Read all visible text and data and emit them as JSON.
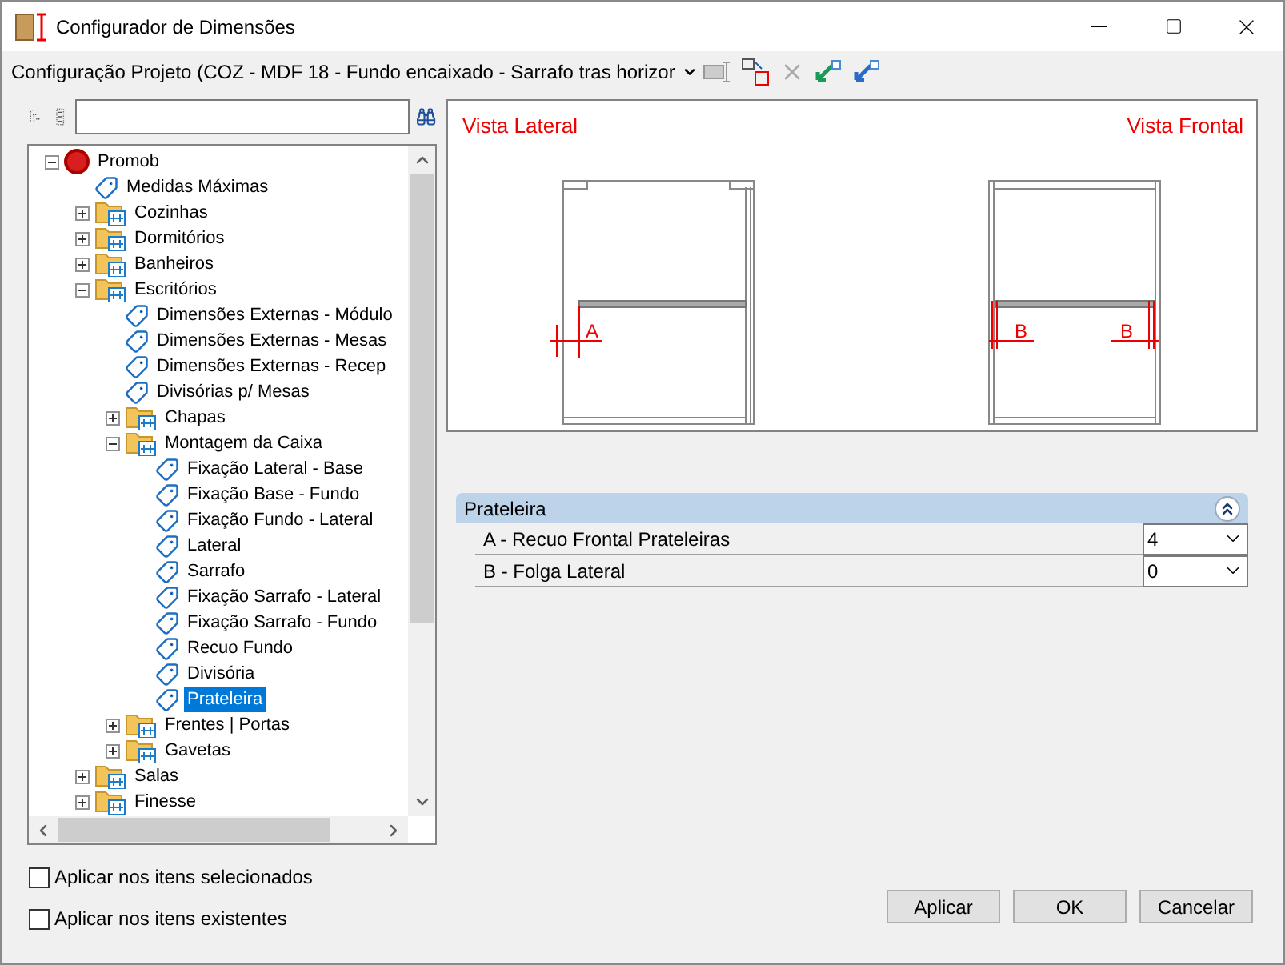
{
  "window": {
    "title": "Configurador de Dimensões"
  },
  "config": {
    "value": "Configuração Projeto (COZ - MDF 18 - Fundo encaixado - Sarrafo tras horizor"
  },
  "tree": [
    {
      "label": "Promob",
      "kind": "root",
      "expanded": true,
      "selected": false,
      "children": [
        {
          "label": "Medidas Máximas",
          "kind": "item",
          "selected": false
        },
        {
          "label": "Cozinhas",
          "kind": "folder",
          "expanded": false,
          "selected": false
        },
        {
          "label": "Dormitórios",
          "kind": "folder",
          "expanded": false,
          "selected": false
        },
        {
          "label": "Banheiros",
          "kind": "folder",
          "expanded": false,
          "selected": false
        },
        {
          "label": "Escritórios",
          "kind": "folder",
          "expanded": true,
          "selected": false,
          "children": [
            {
              "label": "Dimensões Externas - Módulo",
              "kind": "item",
              "selected": false
            },
            {
              "label": "Dimensões Externas - Mesas",
              "kind": "item",
              "selected": false
            },
            {
              "label": "Dimensões Externas - Recep",
              "kind": "item",
              "selected": false
            },
            {
              "label": "Divisórias p/ Mesas",
              "kind": "item",
              "selected": false
            },
            {
              "label": "Chapas",
              "kind": "folder",
              "expanded": false,
              "selected": false
            },
            {
              "label": "Montagem da Caixa",
              "kind": "folder",
              "expanded": true,
              "selected": false,
              "children": [
                {
                  "label": "Fixação Lateral - Base",
                  "kind": "item",
                  "selected": false
                },
                {
                  "label": "Fixação Base - Fundo",
                  "kind": "item",
                  "selected": false
                },
                {
                  "label": "Fixação Fundo - Lateral",
                  "kind": "item",
                  "selected": false
                },
                {
                  "label": "Lateral",
                  "kind": "item",
                  "selected": false
                },
                {
                  "label": "Sarrafo",
                  "kind": "item",
                  "selected": false
                },
                {
                  "label": "Fixação Sarrafo - Lateral",
                  "kind": "item",
                  "selected": false
                },
                {
                  "label": "Fixação Sarrafo - Fundo",
                  "kind": "item",
                  "selected": false
                },
                {
                  "label": "Recuo Fundo",
                  "kind": "item",
                  "selected": false
                },
                {
                  "label": "Divisória",
                  "kind": "item",
                  "selected": false
                },
                {
                  "label": "Prateleira",
                  "kind": "item",
                  "selected": true
                }
              ]
            },
            {
              "label": "Frentes | Portas",
              "kind": "folder",
              "expanded": false,
              "selected": false
            },
            {
              "label": "Gavetas",
              "kind": "folder",
              "expanded": false,
              "selected": false
            }
          ]
        },
        {
          "label": "Salas",
          "kind": "folder",
          "expanded": false,
          "selected": false
        },
        {
          "label": "Finesse",
          "kind": "folder",
          "expanded": false,
          "selected": false
        }
      ]
    }
  ],
  "drawing": {
    "left_title": "Vista Lateral",
    "right_title": "Vista Frontal",
    "left_marks": [
      "A"
    ],
    "right_marks": [
      "B",
      "B"
    ]
  },
  "section": {
    "title": "Prateleira",
    "expanded": true,
    "rows": [
      {
        "label": "A - Recuo Frontal Prateleiras",
        "value": "4"
      },
      {
        "label": "B - Folga Lateral",
        "value": "0"
      }
    ]
  },
  "options": [
    {
      "label": "Aplicar nos itens selecionados",
      "checked": false
    },
    {
      "label": "Aplicar nos itens existentes",
      "checked": false
    }
  ],
  "buttons": [
    "Aplicar",
    "OK",
    "Cancelar"
  ]
}
